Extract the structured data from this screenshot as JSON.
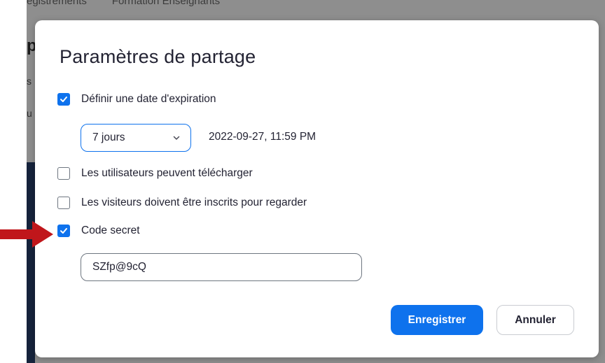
{
  "background": {
    "breadcrumb": [
      "egistrements",
      "Formation Enseignants"
    ],
    "heading_fragment": "p",
    "line1_fragment": "s",
    "line2_fragment": "u"
  },
  "dialog": {
    "title": "Paramètres de partage",
    "options": {
      "expiration": {
        "label": "Définir une date d'expiration",
        "checked": true
      },
      "download": {
        "label": "Les utilisateurs peuvent télécharger",
        "checked": false
      },
      "registration": {
        "label": "Les visiteurs doivent être inscrits pour regarder",
        "checked": false
      },
      "passcode": {
        "label": "Code secret",
        "checked": true
      }
    },
    "expiration_select": {
      "selected": "7 jours"
    },
    "expiration_datetime": "2022-09-27, 11:59 PM",
    "passcode_value": "SZfp@9cQ",
    "buttons": {
      "save": "Enregistrer",
      "cancel": "Annuler"
    }
  },
  "colors": {
    "accent": "#0e72ed",
    "overlay": "#8e8e8e",
    "annotation_arrow": "#c0161b"
  },
  "icons": {
    "checkbox_checked": "checkmark-icon",
    "select": "chevron-down-icon",
    "annotation": "red-arrow-right-icon"
  }
}
